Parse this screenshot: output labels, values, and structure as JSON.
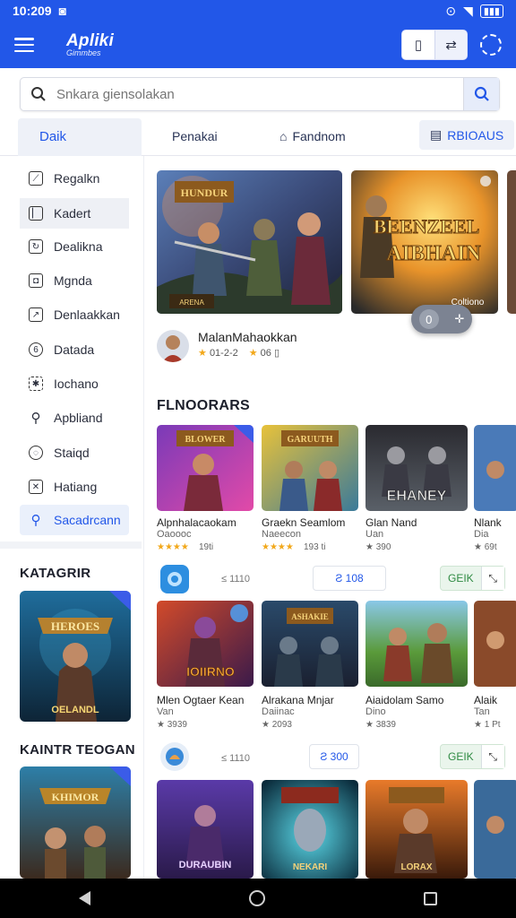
{
  "status": {
    "time": "10:209"
  },
  "appbar": {
    "title": "Apliki",
    "subtitle": "Gimmbes"
  },
  "search": {
    "placeholder": "Snkara giensolakan"
  },
  "tabs": {
    "first": "Daik",
    "t1": "Penakai",
    "t2": "Fandnom",
    "t3": "RBIOAUS"
  },
  "sidebar": {
    "items": [
      {
        "label": "Regalkn",
        "icon": "edit-icon"
      },
      {
        "label": "Kadert",
        "icon": "book-icon"
      },
      {
        "label": "Dealikna",
        "icon": "refresh-icon"
      },
      {
        "label": "Mgnda",
        "icon": "lock-icon"
      },
      {
        "label": "Denlaakkan",
        "icon": "chart-icon"
      },
      {
        "label": "Datada",
        "icon": "clock-icon"
      },
      {
        "label": "Iochano",
        "icon": "puzzle-icon"
      },
      {
        "label": "Apbliand",
        "icon": "search-icon"
      },
      {
        "label": "Staiqd",
        "icon": "globe-icon"
      },
      {
        "label": "Hatiang",
        "icon": "close-box-icon"
      },
      {
        "label": "Sacadrcann",
        "icon": "search-icon"
      }
    ]
  },
  "categories": [
    {
      "title": "KATAGRIR",
      "caption": "OELANDL"
    },
    {
      "title": "KAINTR TEOGAN",
      "caption": ""
    }
  ],
  "featured": {
    "developer": "MalanMahaokkan",
    "rating": "01-2-2",
    "count": "06"
  },
  "section_title": "FLNOORARS",
  "row1": [
    {
      "title": "Alpnhalacaokam",
      "sub": "Oaoooc",
      "meta": "19ti",
      "stars": "★★★★"
    },
    {
      "title": "Graekn Seamlom",
      "sub": "Naeecon",
      "meta": "193 ti",
      "stars": "★★★★"
    },
    {
      "title": "Glan Nand",
      "sub": "Uan",
      "meta": "★ 390",
      "stars": ""
    },
    {
      "title": "Nlank",
      "sub": "Dia",
      "meta": "★ 69t",
      "stars": ""
    }
  ],
  "bar1": {
    "small": "≤ 1110",
    "pill": "Ƨ 108",
    "get": "GEIK"
  },
  "row2": [
    {
      "title": "Mlen Ogtaer Kean",
      "sub": "Van",
      "meta": "★ 3939"
    },
    {
      "title": "Alrakana Mnjar",
      "sub": "Daiinac",
      "meta": "★ 2093"
    },
    {
      "title": "Aiaidolam Samo",
      "sub": "Dino",
      "meta": "★ 3839"
    },
    {
      "title": "Alaik",
      "sub": "Tan",
      "meta": "★ 1 Pt"
    }
  ],
  "bar2": {
    "small": "≤ 1110",
    "pill": "Ƨ 300",
    "get": "GEIK"
  },
  "art_labels": {
    "hero1": "HUNDUR",
    "hero2": "BEENZEEL AIBHAIN",
    "hero2_corner": "Coltiono",
    "g1": "BLOWER",
    "g2": "GARUUTH",
    "g3": "EHANEY",
    "g5": "IOIIRNO",
    "g6": "ASHAKIE",
    "g9": "DURAUBIN",
    "g10": "NEKARI",
    "g11": "LORAX"
  }
}
